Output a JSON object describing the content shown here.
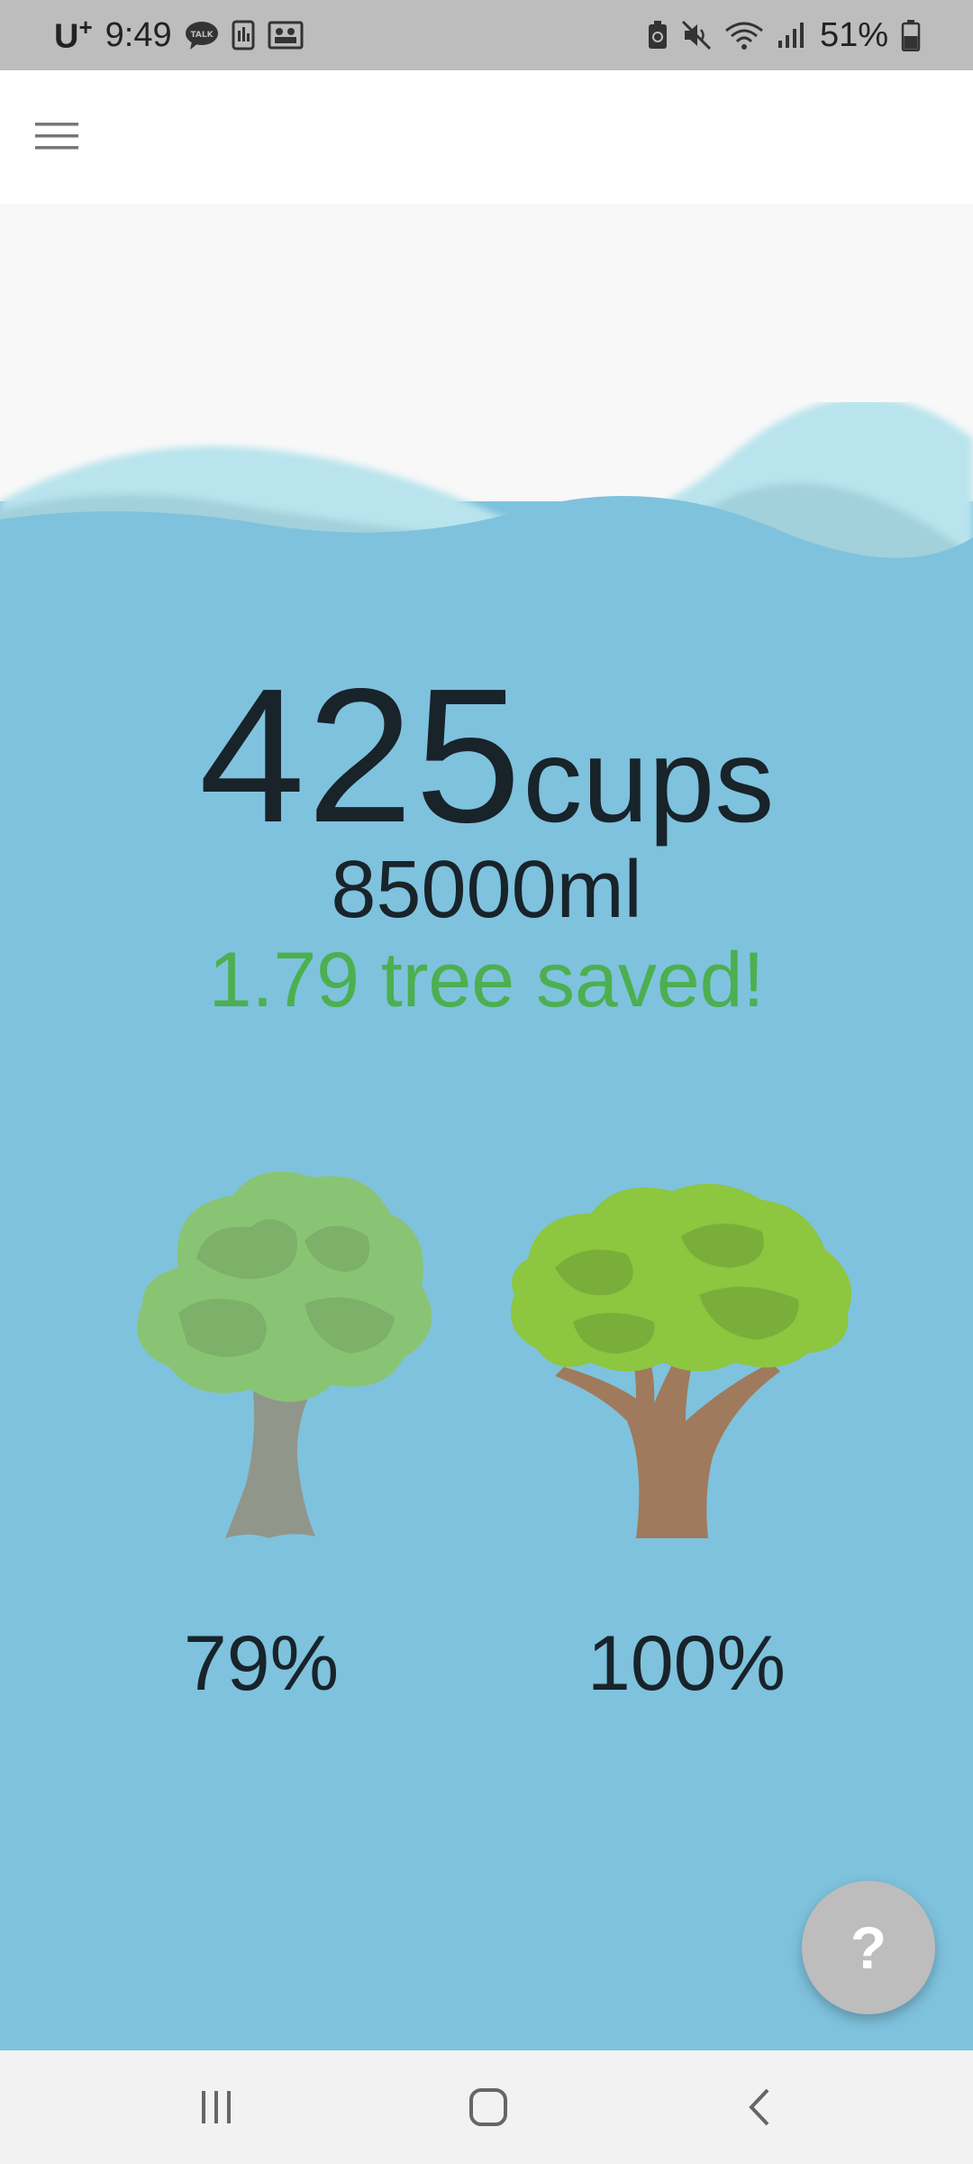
{
  "status_bar": {
    "carrier": "U",
    "carrier_sup": "+",
    "time": "9:49",
    "talk_label": "TALK",
    "battery": "51%",
    "icons": [
      "talk-icon",
      "sim-icon",
      "gallery-icon",
      "battery-saver-icon",
      "mute-icon",
      "wifi-icon",
      "signal-icon",
      "battery-icon"
    ]
  },
  "app_bar": {
    "menu_icon": "hamburger-menu-icon"
  },
  "stats": {
    "cups_count": "425",
    "cups_unit": "cups",
    "volume": "85000ml",
    "saved": "1.79 tree saved!"
  },
  "trees": [
    {
      "name": "partial-tree",
      "percent": "79%",
      "progress": 0.79
    },
    {
      "name": "full-tree",
      "percent": "100%",
      "progress": 1.0
    }
  ],
  "fab": {
    "label": "?"
  },
  "nav_bar": {
    "icons": [
      "recents-icon",
      "home-icon",
      "back-icon"
    ]
  },
  "colors": {
    "status_bar": "#bdbdbd",
    "water": "#7fc2dd",
    "saved_text": "#4caf50",
    "text": "#18232a",
    "fab": "#bdbdbd"
  }
}
